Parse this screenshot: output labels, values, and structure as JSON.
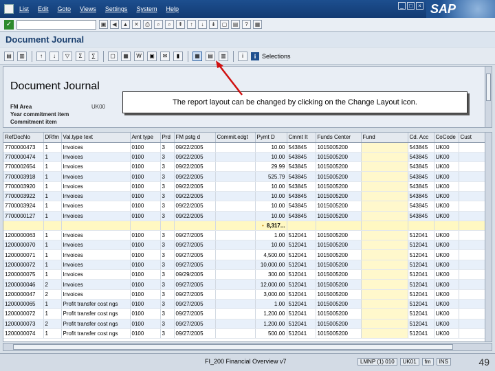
{
  "menubar": {
    "items": [
      "List",
      "Edit",
      "Goto",
      "Views",
      "Settings",
      "System",
      "Help"
    ]
  },
  "logo": "SAP",
  "title": "Document Journal",
  "header": {
    "report_title": "Document Journal",
    "fm_area_label": "FM Area",
    "fm_area_value": "UK00",
    "commitment_year_label": "Year commitment item",
    "commitment_item_label": "Commitment item"
  },
  "toolbar": {
    "selections_label": "Selections"
  },
  "callout": "The report layout can be changed by clicking on the Change Layout icon.",
  "table": {
    "columns": [
      "RefDocNo",
      "DRfm",
      "Val.type text",
      "Amt type",
      "Prd",
      "FM pstg d",
      "Commit.edgt",
      "Pymt D",
      "Cmmt It",
      "Funds Center",
      "Fund",
      "Cd. Acc",
      "CoCode",
      "Cust"
    ],
    "rows": [
      [
        "7700000473",
        "1",
        "Invoices",
        "0100",
        "3",
        "09/22/2005",
        "",
        "10.00",
        "543845",
        "1015005200",
        "",
        "543845",
        "UK00",
        ""
      ],
      [
        "7700000474",
        "1",
        "Invoices",
        "0100",
        "3",
        "09/22/2005",
        "",
        "10.00",
        "543845",
        "1015005200",
        "",
        "543845",
        "UK00",
        ""
      ],
      [
        "7700002654",
        "1",
        "Invoices",
        "0100",
        "3",
        "09/22/2005",
        "",
        "29.99",
        "543845",
        "1015005200",
        "",
        "543845",
        "UK00",
        ""
      ],
      [
        "7700003918",
        "1",
        "Invoices",
        "0100",
        "3",
        "09/22/2005",
        "",
        "525.79",
        "543845",
        "1015005200",
        "",
        "543845",
        "UK00",
        ""
      ],
      [
        "7700003920",
        "1",
        "Invoices",
        "0100",
        "3",
        "09/22/2005",
        "",
        "10.00",
        "543845",
        "1015005200",
        "",
        "543845",
        "UK00",
        ""
      ],
      [
        "7700003922",
        "1",
        "Invoices",
        "0100",
        "3",
        "09/22/2005",
        "",
        "10.00",
        "543845",
        "1015005200",
        "",
        "543845",
        "UK00",
        ""
      ],
      [
        "7700003924",
        "1",
        "Invoices",
        "0100",
        "3",
        "09/22/2005",
        "",
        "10.00",
        "543845",
        "1015005200",
        "",
        "543845",
        "UK00",
        ""
      ],
      [
        "7700000127",
        "1",
        "Invoices",
        "0100",
        "3",
        "09/22/2005",
        "",
        "10.00",
        "543845",
        "1015005200",
        "",
        "543845",
        "UK00",
        ""
      ]
    ],
    "subtotal": {
      "marker": "•",
      "amount": "8,317..."
    },
    "rows2": [
      [
        "1200000063",
        "1",
        "Invoices",
        "0100",
        "3",
        "09/27/2005",
        "",
        "1.00",
        "512041",
        "1015005200",
        "",
        "512041",
        "UK00",
        ""
      ],
      [
        "1200000070",
        "1",
        "Invoices",
        "0100",
        "3",
        "09/27/2005",
        "",
        "10.00",
        "512041",
        "1015005200",
        "",
        "512041",
        "UK00",
        ""
      ],
      [
        "1200000071",
        "1",
        "Invoices",
        "0100",
        "3",
        "09/27/2005",
        "",
        "4,500.00",
        "512041",
        "1015005200",
        "",
        "512041",
        "UK00",
        ""
      ],
      [
        "1200000072",
        "1",
        "Invoices",
        "0100",
        "3",
        "09/27/2005",
        "",
        "10,000.00",
        "512041",
        "1015005200",
        "",
        "512041",
        "UK00",
        ""
      ],
      [
        "1200000075",
        "1",
        "Invoices",
        "0100",
        "3",
        "09/29/2005",
        "",
        "300.00",
        "512041",
        "1015005200",
        "",
        "512041",
        "UK00",
        ""
      ],
      [
        "1200000046",
        "2",
        "Invoices",
        "0100",
        "3",
        "09/27/2005",
        "",
        "12,000.00",
        "512041",
        "1015005200",
        "",
        "512041",
        "UK00",
        ""
      ],
      [
        "1200000047",
        "2",
        "Invoices",
        "0100",
        "3",
        "09/27/2005",
        "",
        "3,000.00",
        "512041",
        "1015005200",
        "",
        "512041",
        "UK00",
        ""
      ],
      [
        "1200000065",
        "1",
        "Profit transfer cost ngs",
        "0100",
        "3",
        "09/27/2005",
        "",
        "1.00",
        "512041",
        "1015005200",
        "",
        "512041",
        "UK00",
        ""
      ],
      [
        "1200000072",
        "1",
        "Profit transfer cost ngs",
        "0100",
        "3",
        "09/27/2005",
        "",
        "1,200.00",
        "512041",
        "1015005200",
        "",
        "512041",
        "UK00",
        ""
      ],
      [
        "1200000073",
        "2",
        "Profit transfer cost ngs",
        "0100",
        "3",
        "09/27/2005",
        "",
        "1,200.00",
        "512041",
        "1015005200",
        "",
        "512041",
        "UK00",
        ""
      ],
      [
        "1200000074",
        "1",
        "Profit transfer cost ngs",
        "0100",
        "3",
        "09/27/2005",
        "",
        "500.00",
        "512041",
        "1015005200",
        "",
        "512041",
        "UK00",
        ""
      ]
    ]
  },
  "footer": {
    "course": "FI_200 Financial Overview v7",
    "status": [
      "LMNP (1) 010",
      "UK01",
      "fm",
      "INS"
    ],
    "page": "49"
  }
}
